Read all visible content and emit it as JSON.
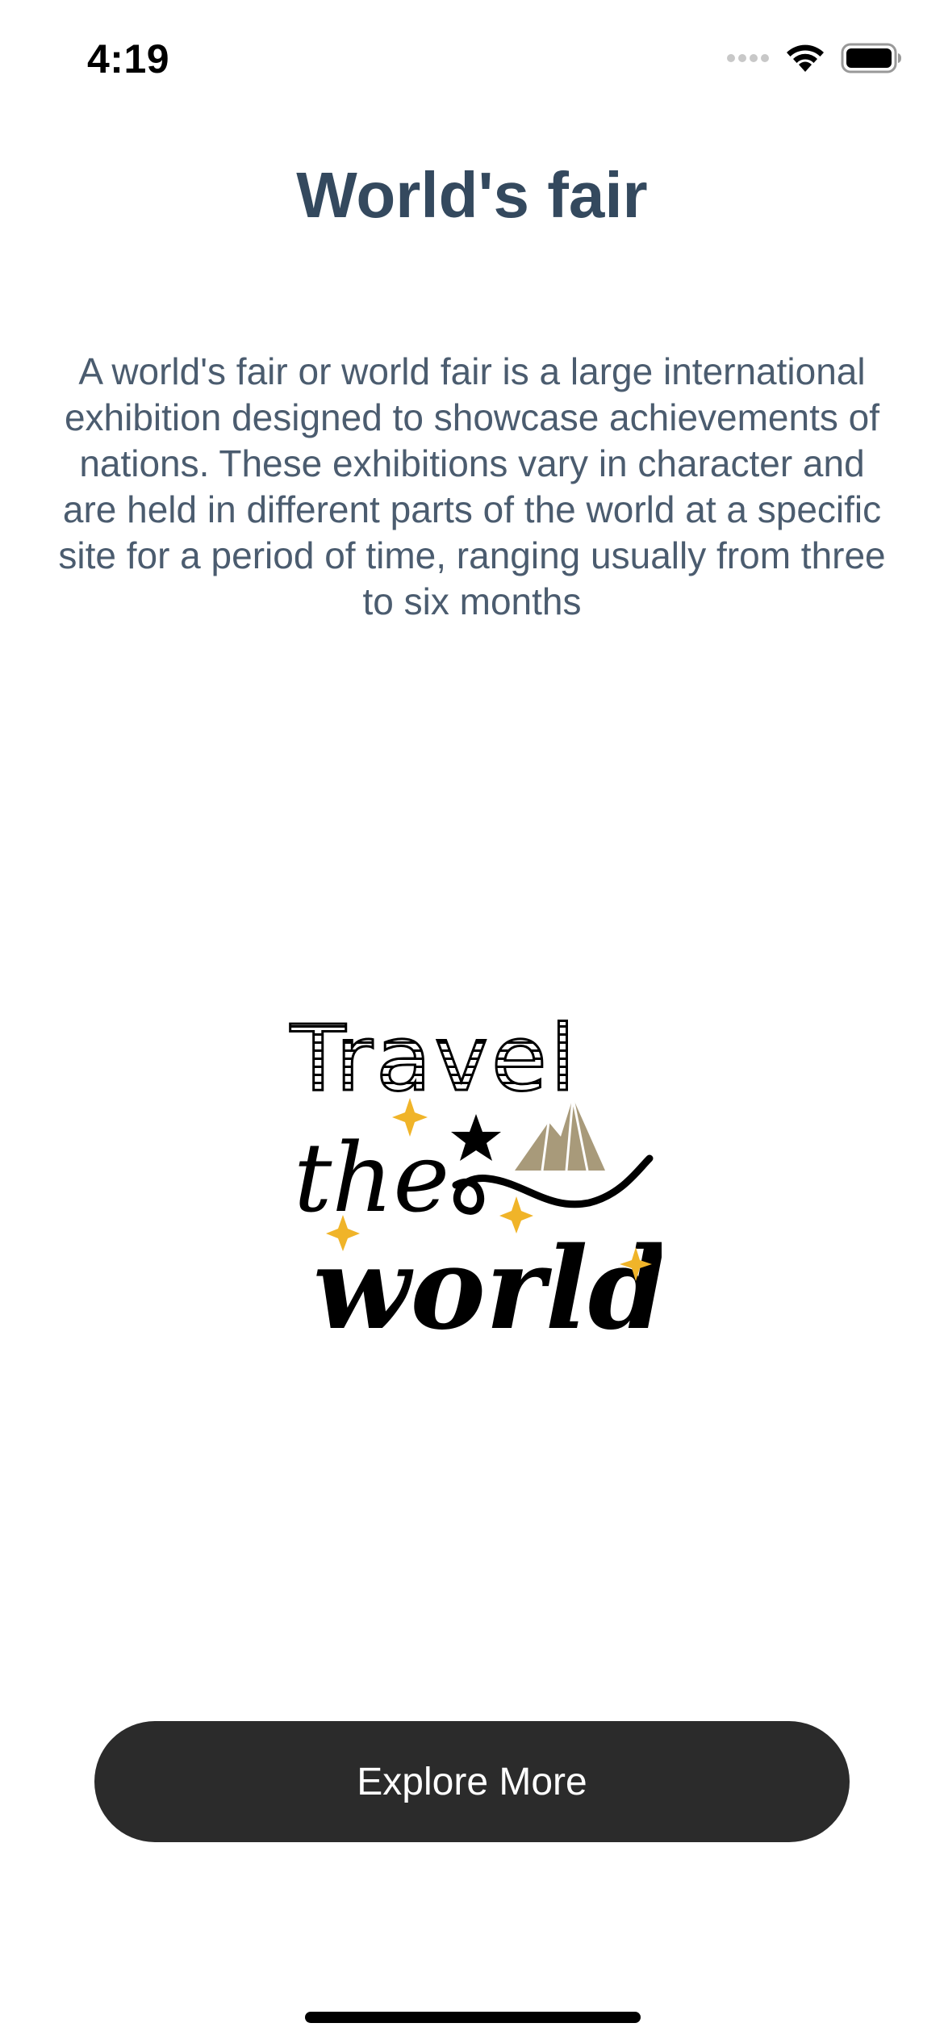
{
  "status_bar": {
    "time": "4:19",
    "icons": [
      "signal-dots-icon",
      "wifi-icon",
      "battery-icon"
    ]
  },
  "page": {
    "title": "World's fair",
    "description": "A world's fair or world fair is a large international exhibition designed to showcase achievements of nations. These exhibitions vary in character and are held in different parts of the world at a specific site for a period of time, ranging usually from three to six months"
  },
  "illustration": {
    "line1": "Travel",
    "line2": "the",
    "line3": "world",
    "colors": {
      "ink": "#000000",
      "sparkle": "#f0b429",
      "mountain": "#a89a7a"
    }
  },
  "actions": {
    "explore_label": "Explore More"
  },
  "colors": {
    "title": "#34495e",
    "description": "#4b5c6f",
    "button_bg": "#2b2b2b",
    "button_text": "#ffffff"
  }
}
